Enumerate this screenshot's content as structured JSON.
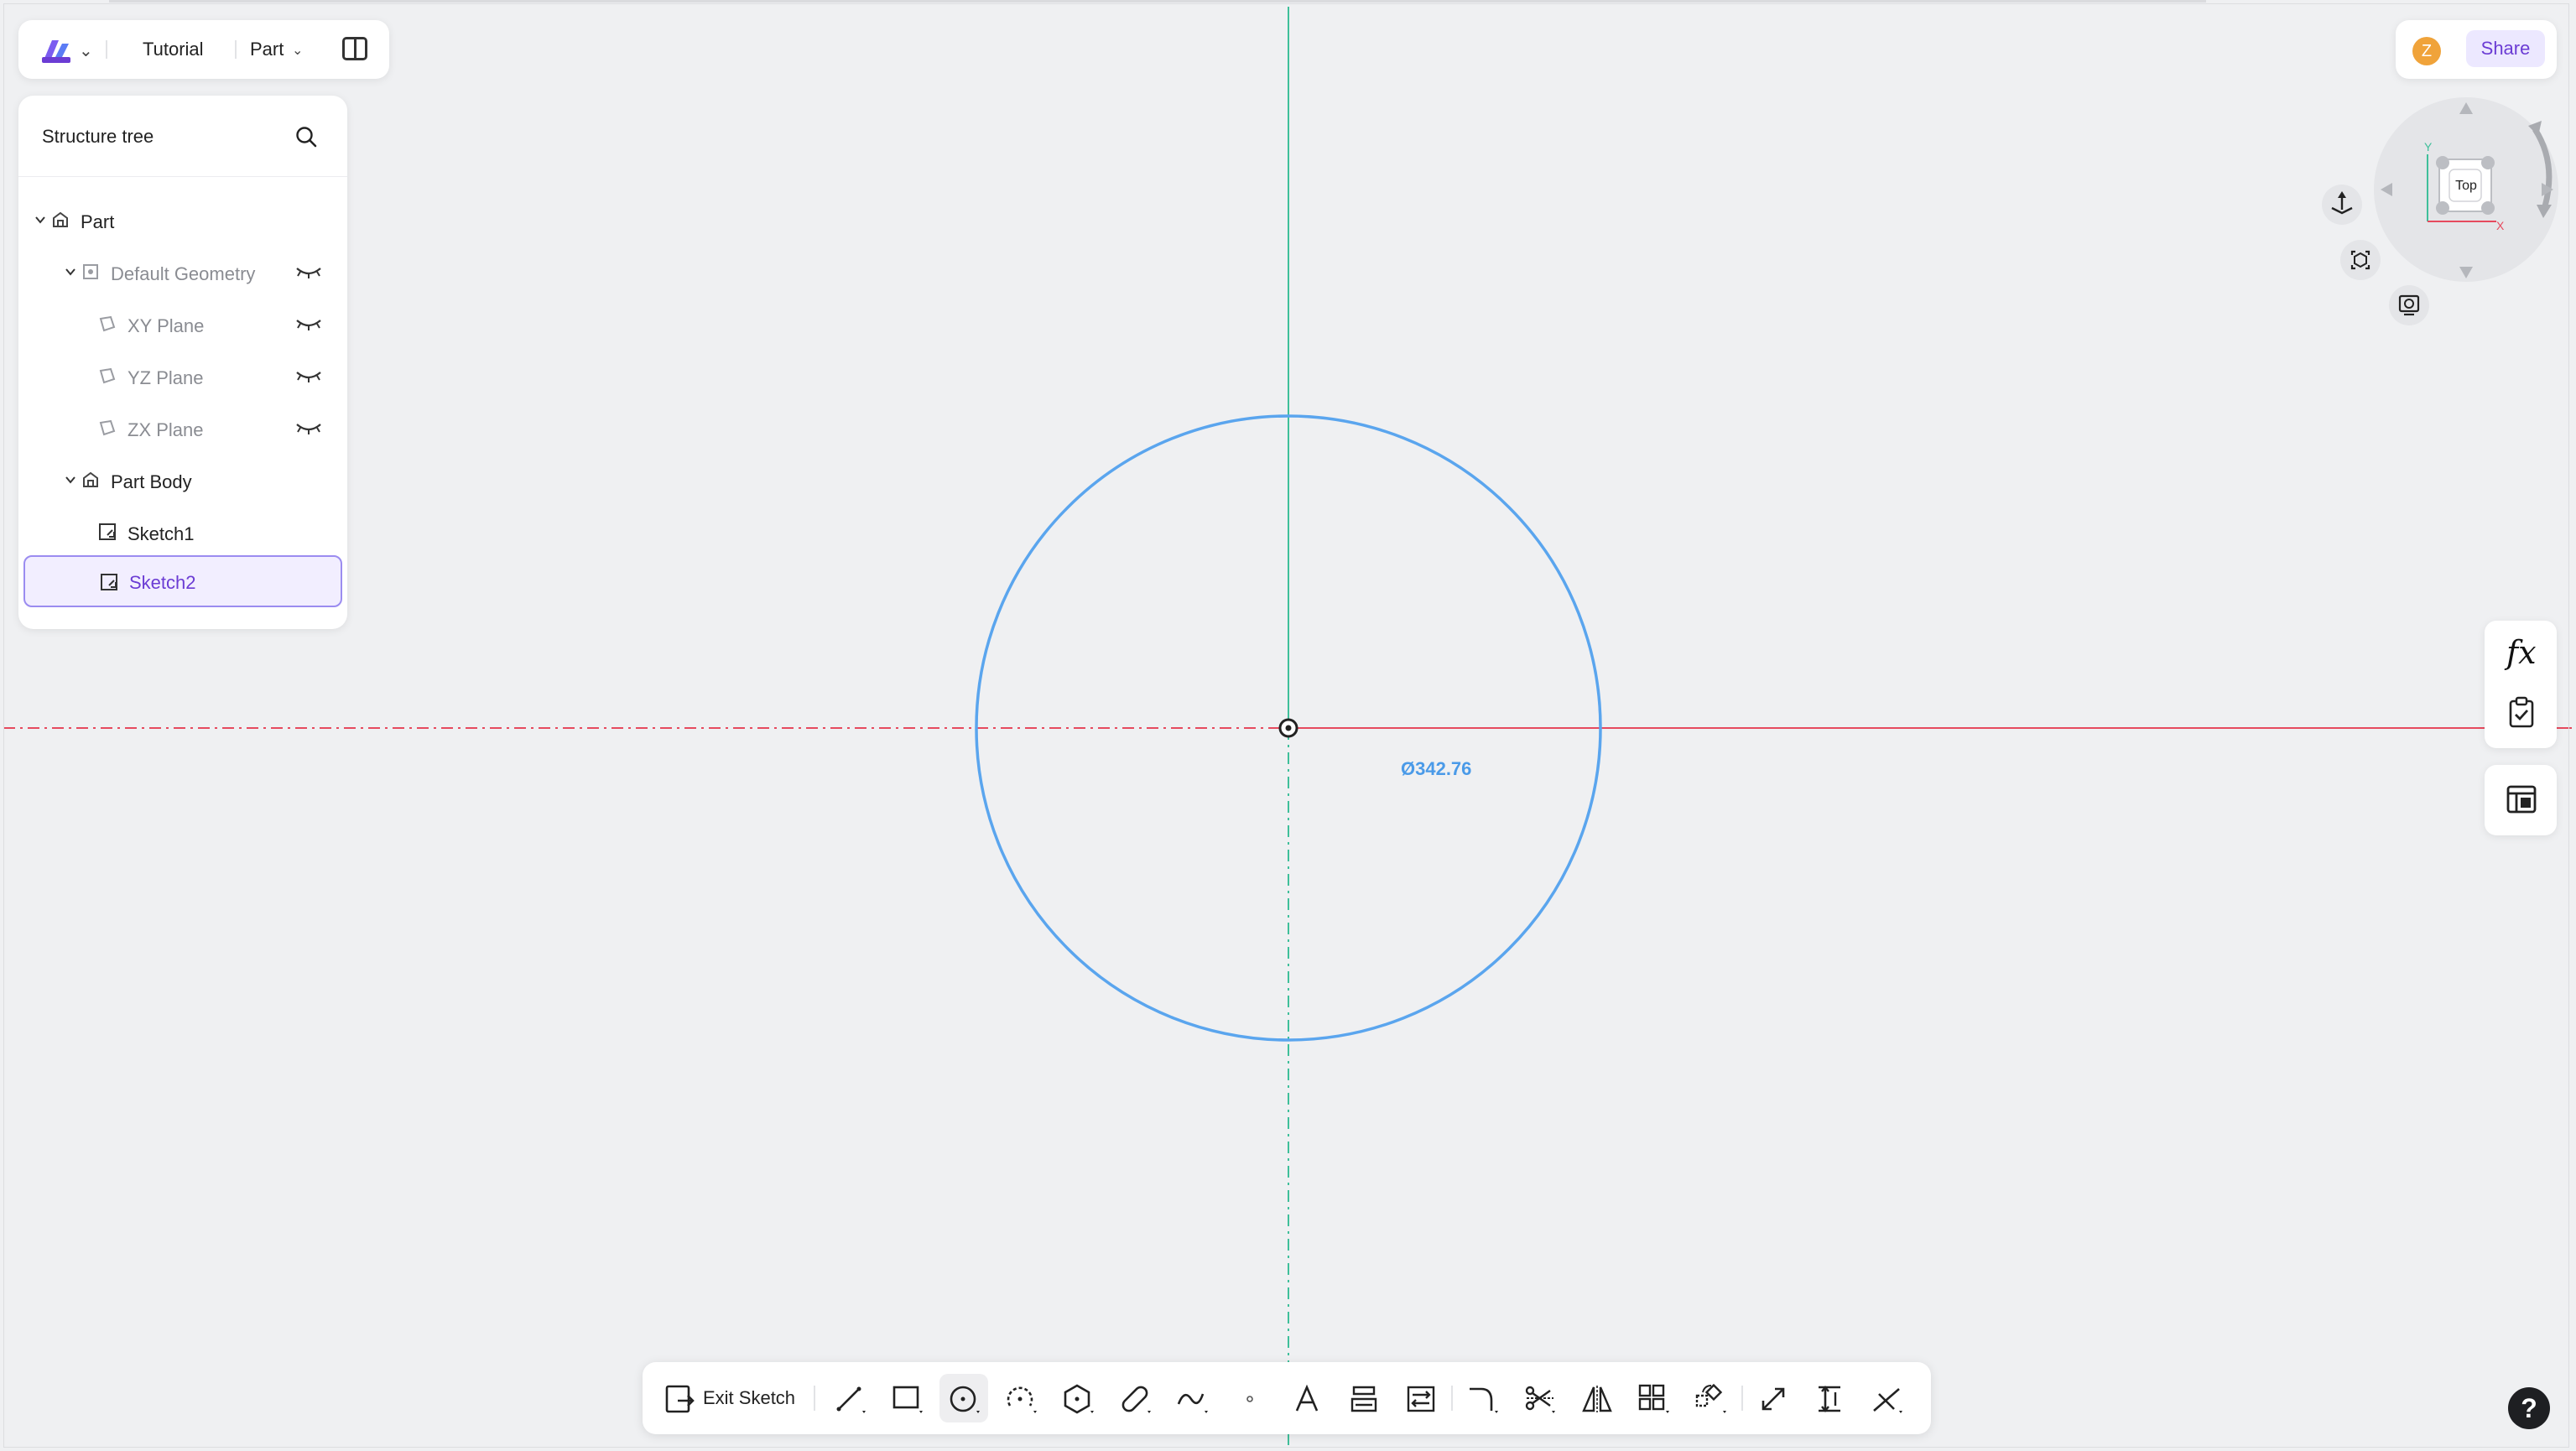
{
  "app": {
    "tab_tutorial": "Tutorial",
    "mode": "Part",
    "icons": {
      "logo": "app-logo-icon",
      "panel_toggle": "panel-toggle-icon"
    }
  },
  "tree": {
    "title": "Structure tree",
    "items": [
      {
        "label": "Part",
        "icon": "part-icon",
        "expanded": true,
        "visible_toggle": false
      },
      {
        "label": "Default Geometry",
        "icon": "geometry-icon",
        "expanded": true,
        "visible_toggle": true
      },
      {
        "label": "XY Plane",
        "icon": "plane-icon",
        "visible_toggle": true
      },
      {
        "label": "YZ Plane",
        "icon": "plane-icon",
        "visible_toggle": true
      },
      {
        "label": "ZX Plane",
        "icon": "plane-icon",
        "visible_toggle": true
      },
      {
        "label": "Part Body",
        "icon": "body-icon",
        "expanded": true
      },
      {
        "label": "Sketch1",
        "icon": "sketch-icon"
      },
      {
        "label": "Sketch2",
        "icon": "sketch-icon",
        "selected": true
      }
    ]
  },
  "header_right": {
    "avatar_letter": "Z",
    "share_label": "Share"
  },
  "viewcube": {
    "face_label": "Top",
    "axis_y": "Y",
    "axis_x": "X"
  },
  "side": {
    "fx_label": "fx"
  },
  "canvas": {
    "dimension_label": "Ø342.76",
    "colors": {
      "circle": "#5aa5ee",
      "x_axis": "#e64a5e",
      "y_axis": "#3fbf9a"
    }
  },
  "toolbar": {
    "exit_label": "Exit Sketch",
    "tools": [
      "line-tool",
      "rectangle-tool",
      "circle-tool",
      "arc-tool",
      "polygon-tool",
      "slot-tool",
      "spline-tool",
      "point-tool",
      "text-tool",
      "project-tool",
      "convert-tool",
      "fillet-tool",
      "trim-tool",
      "mirror-tool",
      "pattern-tool",
      "transform-tool",
      "offset-tool",
      "dimension-tool",
      "constraint-tool"
    ],
    "active_tool": "circle-tool"
  },
  "help_label": "?"
}
